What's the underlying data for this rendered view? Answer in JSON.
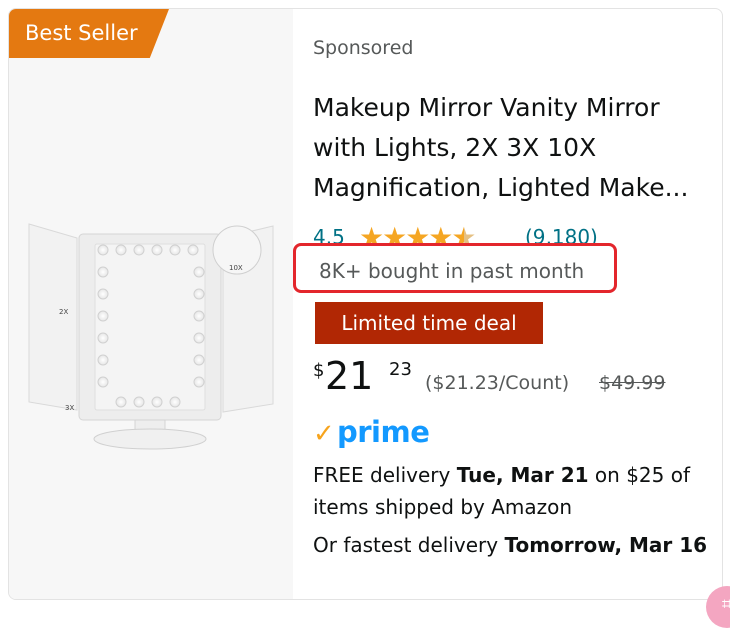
{
  "badge": "Best Seller",
  "sponsored": "Sponsored",
  "title": "Makeup Mirror Vanity Mirror with Lights, 2X 3X 10X Magnification, Lighted Make...",
  "image": {
    "labels": [
      "10X",
      "2X",
      "3X"
    ]
  },
  "rating": {
    "value": "4.5",
    "stars": 4.5,
    "reviews": "(9,180)"
  },
  "bought": "8K+ bought in past month",
  "deal": "Limited time deal",
  "price": {
    "currency": "$",
    "whole": "21",
    "fraction": "23",
    "unit": "($21.23/Count)",
    "was": "$49.99"
  },
  "prime": {
    "check": "✓",
    "word": "prime"
  },
  "delivery": {
    "free_prefix": "FREE delivery ",
    "free_date": "Tue, Mar 21",
    "free_suffix": " on $25 of items shipped by Amazon",
    "fast_prefix": "Or fastest delivery ",
    "fast_date": "Tomorrow, Mar 16"
  },
  "colors": {
    "badge": "#e47911",
    "highlight_box": "#e3262c",
    "deal": "#b12704",
    "link": "#007185",
    "prime": "#1399ff",
    "stars": "#f5a623"
  },
  "icons": {
    "corner": "pink-badge-icon"
  }
}
